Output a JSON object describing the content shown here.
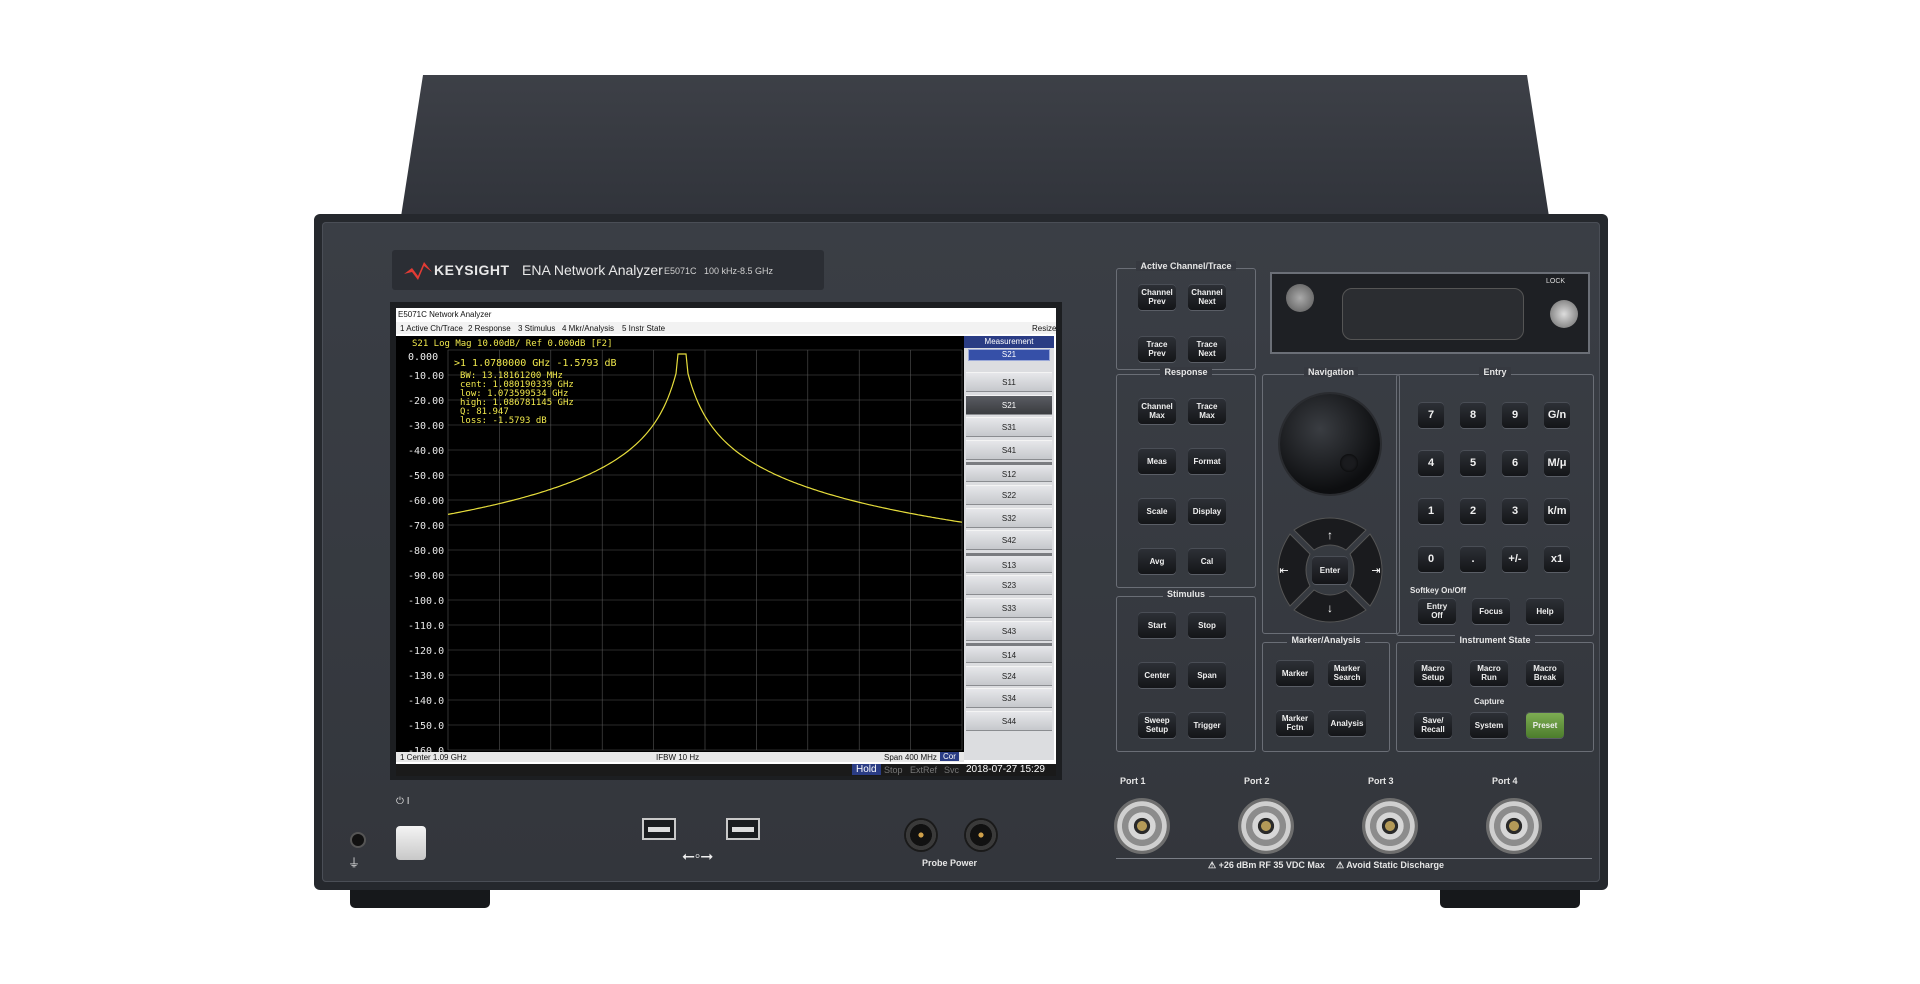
{
  "brand": {
    "name": "KEYSIGHT",
    "product": "ENA Network Analyzer",
    "model": "E5071C",
    "range": "100 kHz-8.5 GHz"
  },
  "screen": {
    "title": "E5071C Network Analyzer",
    "menu": [
      "1 Active Ch/Trace",
      "2 Response",
      "3 Stimulus",
      "4 Mkr/Analysis",
      "5 Instr State"
    ],
    "resize": "Resize",
    "trace_header": "S21 Log Mag 10.00dB/ Ref 0.000dB [F2]",
    "trace_badge": "Tr1",
    "ref_value": "0.000",
    "yticks": [
      "-10.00",
      "-20.00",
      "-30.00",
      "-40.00",
      "-50.00",
      "-60.00",
      "-70.00",
      "-80.00",
      "-90.00",
      "-100.0",
      "-110.0",
      "-120.0",
      "-130.0",
      "-140.0",
      "-150.0",
      "-160.0"
    ],
    "marker_line": ">1  1.0780000 GHz -1.5793 dB",
    "marker_stats": [
      "BW:  13.18161200 MHz",
      "cent:  1.080190339 GHz",
      "low:  1.073599534 GHz",
      "high:  1.086781145 GHz",
      "Q:  81.947",
      "loss:  -1.5793 dB"
    ],
    "softkey_title": "Measurement",
    "softkey_current": "S21",
    "softkeys": [
      "S11",
      "S21",
      "S31",
      "S41",
      "S12",
      "S22",
      "S32",
      "S42",
      "S13",
      "S23",
      "S33",
      "S43",
      "S14",
      "S24",
      "S34",
      "S44"
    ],
    "status_left": "1  Center 1.09 GHz",
    "status_mid": "IFBW 10 Hz",
    "status_right": "Span 400 MHz",
    "cor": "Cor",
    "hold": "Hold",
    "stop": "Stop",
    "extref": "ExtRef",
    "svc": "Svc",
    "datetime": "2018-07-27 15:29"
  },
  "panel": {
    "active": {
      "title": "Active Channel/Trace",
      "keys": [
        "Channel\nPrev",
        "Channel\nNext",
        "Trace\nPrev",
        "Trace\nNext"
      ]
    },
    "response": {
      "title": "Response",
      "keys": [
        "Channel\nMax",
        "Trace\nMax",
        "Meas",
        "Format",
        "Scale",
        "Display",
        "Avg",
        "Cal"
      ]
    },
    "stimulus": {
      "title": "Stimulus",
      "keys": [
        "Start",
        "Stop",
        "Center",
        "Span",
        "Sweep\nSetup",
        "Trigger"
      ]
    },
    "navigation": {
      "title": "Navigation",
      "enter": "Enter"
    },
    "entry": {
      "title": "Entry",
      "keys": [
        "7",
        "8",
        "9",
        "G/n",
        "4",
        "5",
        "6",
        "M/μ",
        "1",
        "2",
        "3",
        "k/m",
        "0",
        ".",
        "+/-",
        "x1"
      ],
      "softkey_label": "Softkey On/Off",
      "bottom": [
        "Entry\nOff",
        "Focus",
        "Help"
      ]
    },
    "marker": {
      "title": "Marker/Analysis",
      "keys": [
        "Marker",
        "Marker\nSearch",
        "Marker\nFctn",
        "Analysis"
      ]
    },
    "instr": {
      "title": "Instrument State",
      "keys": [
        "Macro\nSetup",
        "Macro\nRun",
        "Macro\nBreak",
        "Save/\nRecall",
        "System",
        "Preset"
      ],
      "capture": "Capture"
    },
    "lock": "LOCK"
  },
  "ports": {
    "labels": [
      "Port 1",
      "Port 2",
      "Port 3",
      "Port 4"
    ],
    "warning_rf": "+26 dBm RF  35 VDC Max",
    "warning_static": "Avoid Static Discharge"
  },
  "front": {
    "probe": "Probe Power",
    "power": "⏻ I"
  },
  "colors": {
    "trace": "#e6dd3c",
    "screen_bg": "#000000",
    "chassis": "#363940",
    "preset": "#5e8f38"
  }
}
